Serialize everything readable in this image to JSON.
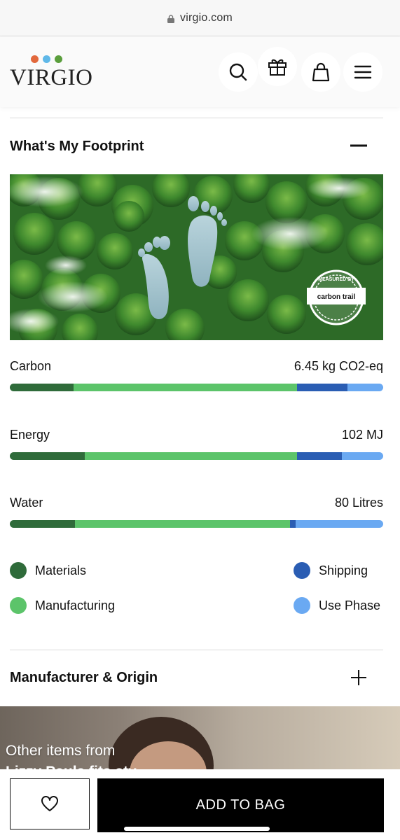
{
  "browser": {
    "url": "virgio.com",
    "lock_icon": "lock-icon"
  },
  "header": {
    "logo_text": "VIRGIO",
    "logo_dot_colors": [
      "#e2683c",
      "#5fb8e8",
      "#5a9e3c"
    ],
    "icons": [
      "search-icon",
      "gift-icon",
      "bag-icon",
      "menu-icon"
    ]
  },
  "footprint": {
    "title": "What's My Footprint",
    "toggle_icon": "minus-icon",
    "badge_text": "carbon trail",
    "metrics": [
      {
        "label": "Carbon",
        "value": "6.45 kg CO2-eq",
        "segments": [
          0.17,
          0.6,
          0.135,
          0.095
        ]
      },
      {
        "label": "Energy",
        "value": "102 MJ",
        "segments": [
          0.2,
          0.57,
          0.12,
          0.11
        ]
      },
      {
        "label": "Water",
        "value": "80 Litres",
        "segments": [
          0.175,
          0.575,
          0.015,
          0.235
        ]
      }
    ],
    "legend": [
      {
        "label": "Materials",
        "color": "#2f6b3a"
      },
      {
        "label": "Shipping",
        "color": "#2a5db3"
      },
      {
        "label": "Manufacturing",
        "color": "#5cc46a"
      },
      {
        "label": "Use Phase",
        "color": "#6aa9f2"
      }
    ]
  },
  "manufacturer": {
    "title": "Manufacturer & Origin",
    "toggle_icon": "plus-icon"
  },
  "promo": {
    "line1": "Other items from",
    "line2": "Lizzy Paula fits sty"
  },
  "actions": {
    "wishlist_icon": "heart-icon",
    "add_to_bag": "ADD TO BAG"
  }
}
